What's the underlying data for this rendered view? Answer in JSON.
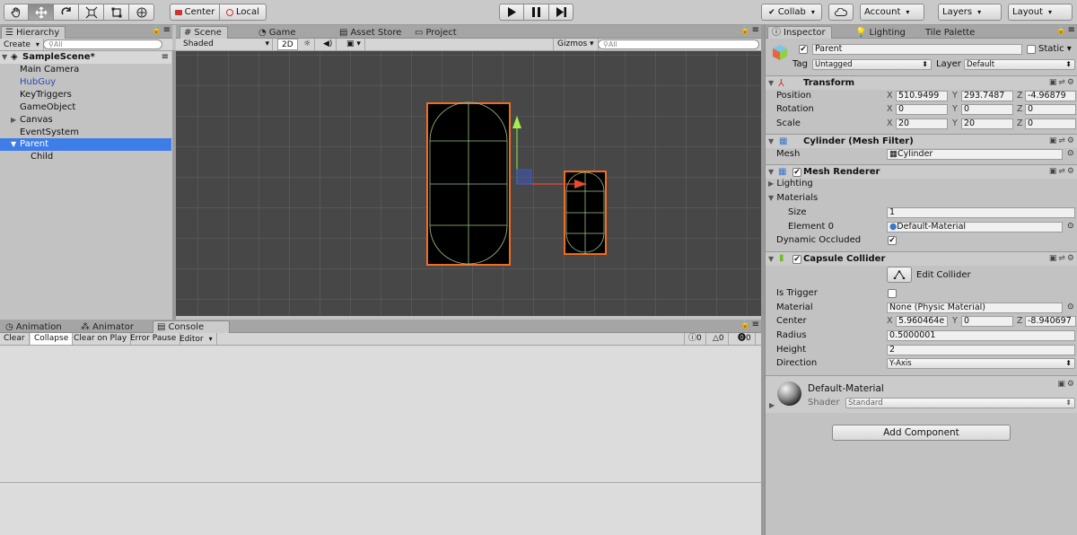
{
  "toolbar": {
    "pivot_label": "Center",
    "space_label": "Local",
    "collab_label": "Collab",
    "account_label": "Account",
    "layers_label": "Layers",
    "layout_label": "Layout"
  },
  "hierarchy": {
    "tab": "Hierarchy",
    "create_label": "Create",
    "search_placeholder": "All",
    "scene_name": "SampleScene*",
    "items": [
      {
        "label": "Main Camera"
      },
      {
        "label": "HubGuy"
      },
      {
        "label": "KeyTriggers"
      },
      {
        "label": "GameObject"
      },
      {
        "label": "Canvas"
      },
      {
        "label": "EventSystem"
      },
      {
        "label": "Parent"
      },
      {
        "label": "Child"
      }
    ]
  },
  "scene_tabs": {
    "scene": "Scene",
    "game": "Game",
    "asset_store": "Asset Store",
    "project": "Project"
  },
  "scene_toolbar": {
    "shading": "Shaded",
    "mode_2d": "2D",
    "gizmos": "Gizmos",
    "search_placeholder": "All"
  },
  "bottom": {
    "tabs": {
      "animation": "Animation",
      "animator": "Animator",
      "console": "Console"
    },
    "buttons": {
      "clear": "Clear",
      "collapse": "Collapse",
      "clear_on_play": "Clear on Play",
      "error_pause": "Error Pause",
      "editor": "Editor"
    },
    "counts": {
      "info": "0",
      "warn": "0",
      "error": "0"
    }
  },
  "inspector": {
    "tabs": {
      "inspector": "Inspector",
      "lighting": "Lighting",
      "tile_palette": "Tile Palette"
    },
    "object_name": "Parent",
    "static_label": "Static",
    "tag_label": "Tag",
    "tag_value": "Untagged",
    "layer_label": "Layer",
    "layer_value": "Default",
    "transform": {
      "title": "Transform",
      "position_label": "Position",
      "position": {
        "x": "510.9499",
        "y": "293.7487",
        "z": "-4.96879"
      },
      "rotation_label": "Rotation",
      "rotation": {
        "x": "0",
        "y": "0",
        "z": "0"
      },
      "scale_label": "Scale",
      "scale": {
        "x": "20",
        "y": "20",
        "z": "0"
      }
    },
    "mesh_filter": {
      "title": "Cylinder (Mesh Filter)",
      "mesh_label": "Mesh",
      "mesh_value": "Cylinder"
    },
    "mesh_renderer": {
      "title": "Mesh Renderer",
      "lighting_label": "Lighting",
      "materials_label": "Materials",
      "size_label": "Size",
      "size_value": "1",
      "element0_label": "Element 0",
      "element0_value": "Default-Material",
      "dynamic_label": "Dynamic Occluded"
    },
    "capsule_collider": {
      "title": "Capsule Collider",
      "edit_label": "Edit Collider",
      "is_trigger_label": "Is Trigger",
      "material_label": "Material",
      "material_value": "None (Physic Material)",
      "center_label": "Center",
      "center": {
        "x": "5.960464e",
        "y": "0",
        "z": "-8.940697"
      },
      "radius_label": "Radius",
      "radius_value": "0.5000001",
      "height_label": "Height",
      "height_value": "2",
      "direction_label": "Direction",
      "direction_value": "Y-Axis"
    },
    "material": {
      "name": "Default-Material",
      "shader_label": "Shader",
      "shader_value": "Standard"
    },
    "add_component": "Add Component"
  },
  "colors": {
    "selection": "#3e7de7",
    "accent_orange": "#f26b21",
    "scene_bg": "#474747",
    "prefab_text": "#2a49b8"
  }
}
